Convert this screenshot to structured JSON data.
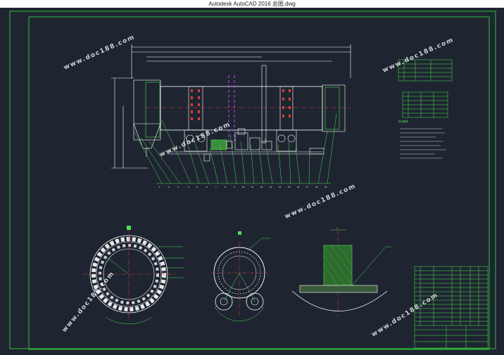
{
  "window": {
    "title": "Autodesk AutoCAD 2016    总图.dwg"
  },
  "watermark": {
    "text": "www.doc188.com"
  },
  "drawing": {
    "part_numbers": [
      "1",
      "2",
      "3",
      "4",
      "5",
      "6",
      "7",
      "8",
      "9",
      "10",
      "11",
      "12",
      "13",
      "14",
      "15",
      "16",
      "17",
      "18",
      "19",
      "20",
      "21"
    ],
    "tech_req_title": "技术要求",
    "section_label": "A"
  },
  "colors": {
    "background": "#1e2531",
    "frame": "#2fbf3a",
    "green": "#4fe04f",
    "white": "#ffffff",
    "red": "#e23b3b",
    "magenta": "#cc44ee",
    "cyan": "#3ad8e0",
    "yellow": "#e8d84a"
  }
}
